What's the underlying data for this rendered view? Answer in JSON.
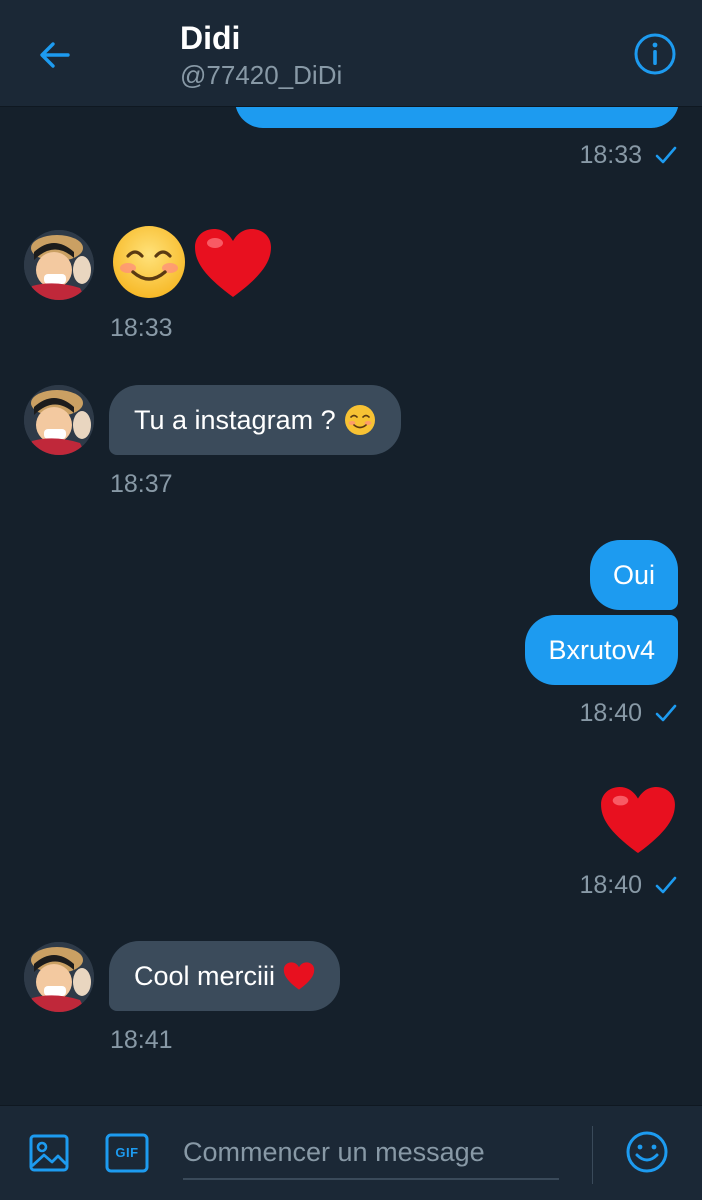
{
  "header": {
    "title": "Didi",
    "handle": "@77420_DiDi"
  },
  "messages": {
    "m0_time": "18:33",
    "m1_time": "18:33",
    "m2_text": "Tu a instagram ?",
    "m2_time": "18:37",
    "m3_text": "Oui",
    "m4_text": "Bxrutov4",
    "m4_time": "18:40",
    "m5_time": "18:40",
    "m6_text": "Cool merciii",
    "m6_time": "18:41"
  },
  "composer": {
    "placeholder": "Commencer un message",
    "gif_label": "GIF"
  },
  "icons": {
    "back": "arrow-left-icon",
    "info": "info-icon",
    "image": "image-icon",
    "gif": "gif-icon",
    "emoji": "emoji-icon",
    "read": "check-icon"
  },
  "colors": {
    "background": "#15202b",
    "bar": "#1b2836",
    "accent": "#1d9bf0",
    "incoming_bubble": "#3b4b5b",
    "muted_text": "#8899a6"
  }
}
